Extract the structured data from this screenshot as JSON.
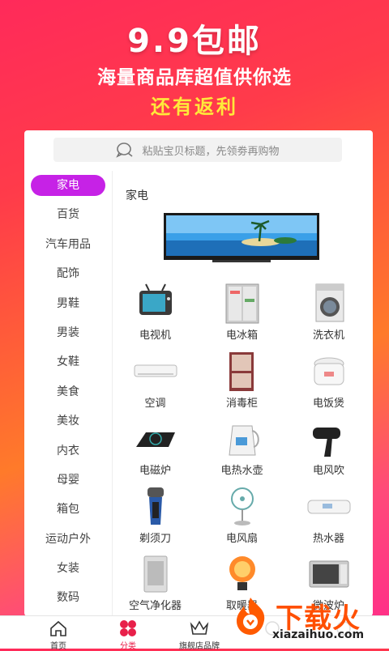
{
  "promo": {
    "price": "9.9包邮",
    "subtitle": "海量商品库超值供你选",
    "rebate": "还有返利"
  },
  "search": {
    "placeholder": "粘贴宝贝标题，先领劵再购物"
  },
  "sidebar": {
    "active_index": 0,
    "items": [
      "家电",
      "百货",
      "汽车用品",
      "配饰",
      "男鞋",
      "男装",
      "女鞋",
      "美食",
      "美妆",
      "内衣",
      "母婴",
      "箱包",
      "运动户外",
      "女装",
      "数码"
    ]
  },
  "content": {
    "category_title": "家电",
    "products": [
      "电视机",
      "电冰箱",
      "洗衣机",
      "空调",
      "消毒柜",
      "电饭煲",
      "电磁炉",
      "电热水壶",
      "电风吹",
      "剃须刀",
      "电风扇",
      "热水器",
      "空气净化器",
      "取暖器",
      "微波炉"
    ]
  },
  "tabbar": {
    "tabs": [
      "首页",
      "分类",
      "旗舰店品牌",
      "",
      ""
    ],
    "active_index": 1
  },
  "watermark": {
    "brand": "下载火",
    "url": "xiazaihuo.com"
  },
  "colors": {
    "accent": "#c622e6",
    "tab_active": "#e8204a",
    "promo_yellow": "#ffe93a"
  }
}
